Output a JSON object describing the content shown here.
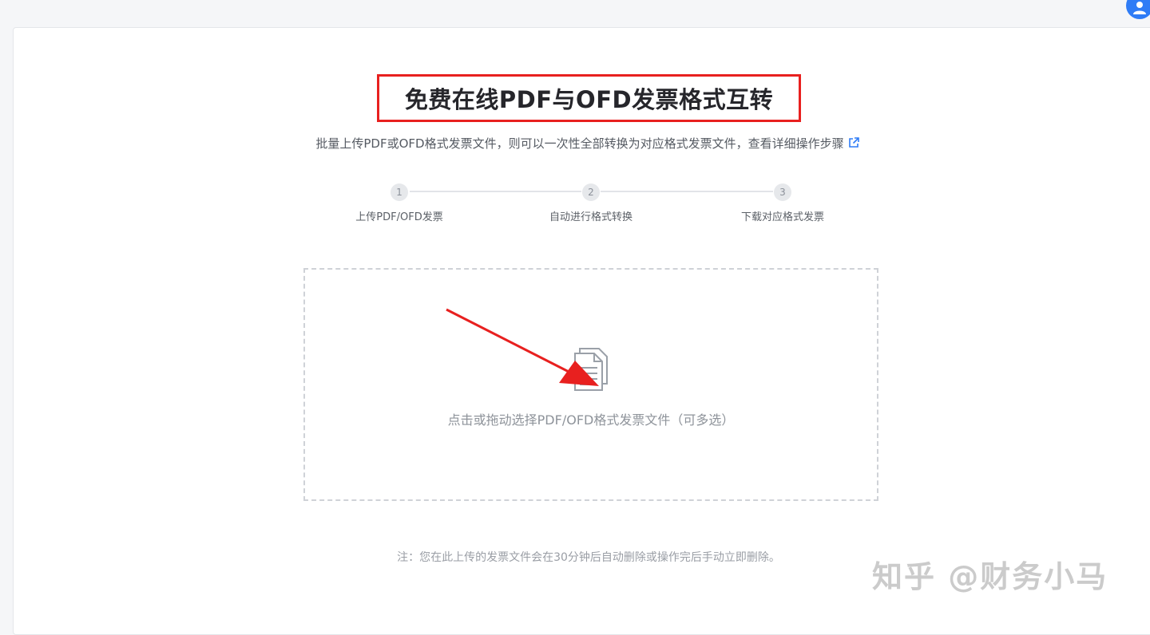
{
  "page": {
    "title": "免费在线PDF与OFD发票格式互转",
    "subtitle": "批量上传PDF或OFD格式发票文件，则可以一次性全部转换为对应格式发票文件，查看详细操作步骤"
  },
  "steps": [
    {
      "number": "1",
      "label": "上传PDF/OFD发票"
    },
    {
      "number": "2",
      "label": "自动进行格式转换"
    },
    {
      "number": "3",
      "label": "下载对应格式发票"
    }
  ],
  "dropzone": {
    "text": "点击或拖动选择PDF/OFD格式发票文件（可多选）",
    "icon": "document-stack-icon"
  },
  "note": "注：您在此上传的发票文件会在30分钟后自动删除或操作完后手动立即删除。",
  "watermark": "知乎 @财务小马",
  "colors": {
    "highlight_border": "#e8201f",
    "arrow": "#e8201f",
    "accent": "#2f7cf6"
  }
}
